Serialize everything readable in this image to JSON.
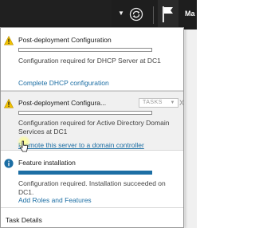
{
  "toolbar": {
    "dropdown_icon": "caret-down-icon",
    "refresh_icon": "refresh-icon",
    "flag_icon": "notification-flag-icon",
    "manage_label": "Ma"
  },
  "notifications": [
    {
      "icon": "warning-icon",
      "title": "Post-deployment Configuration",
      "progress": 0,
      "description": "Configuration required for DHCP Server at DC1",
      "link": "Complete DHCP configuration"
    },
    {
      "icon": "warning-icon",
      "title": "Post-deployment Configura...",
      "tasks_label": "TASKS",
      "close_label": "X",
      "progress": 0,
      "description": "Configuration required for Active Directory Domain Services at DC1",
      "link": "Promote this server to a domain controller"
    },
    {
      "icon": "info-icon",
      "title": "Feature installation",
      "progress": 1,
      "description": "Configuration required. Installation succeeded on DC1.",
      "link": "Add Roles and Features"
    }
  ],
  "footer": {
    "task_details": "Task Details"
  },
  "colors": {
    "toolbar_bg": "#1e1e1e",
    "link": "#1c6ea4",
    "warning": "#f2c200",
    "info": "#1c6ea4",
    "progress_fill": "#1c6ea4"
  }
}
